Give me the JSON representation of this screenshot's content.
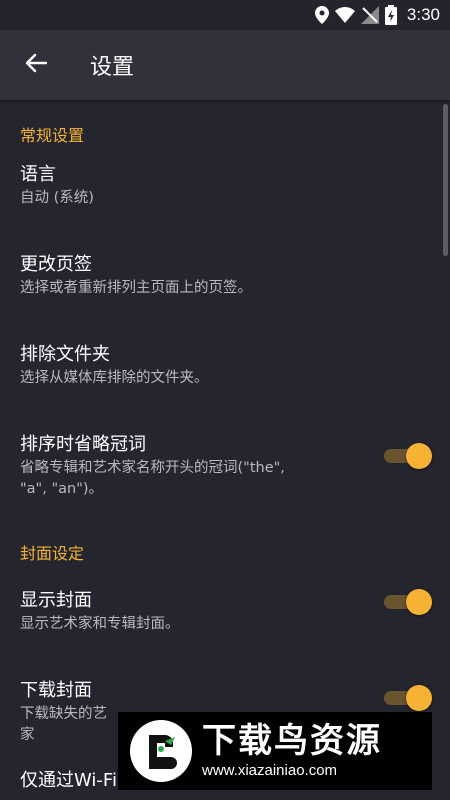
{
  "status_bar": {
    "time": "3:30"
  },
  "app_bar": {
    "title": "设置"
  },
  "sections": {
    "general": {
      "header": "常规设置",
      "language": {
        "title": "语言",
        "summary": "自动 (系统)"
      },
      "tabs": {
        "title": "更改页签",
        "summary": "选择或者重新排列主页面上的页签。"
      },
      "exclude": {
        "title": "排除文件夹",
        "summary": "选择从媒体库排除的文件夹。"
      },
      "ignore_articles": {
        "title": "排序时省略冠词",
        "summary_line1": "省略专辑和艺术家名称开头的冠词(\"the\",",
        "summary_line2": "\"a\", \"an\")。",
        "enabled": true
      }
    },
    "covers": {
      "header": "封面设定",
      "show_covers": {
        "title": "显示封面",
        "summary": "显示艺术家和专辑封面。",
        "enabled": true
      },
      "download_covers": {
        "title": "下载封面",
        "summary_line1": "下载缺失的艺",
        "summary_line2": "家",
        "enabled": true
      },
      "partial_next": {
        "title": "仅通过Wi-Fi下载"
      }
    }
  },
  "watermark": {
    "name": "下载鸟资源",
    "url": "www.xiazainiao.com"
  },
  "colors": {
    "accent": "#f5b234",
    "background": "#252530",
    "appbar": "#31313c"
  }
}
